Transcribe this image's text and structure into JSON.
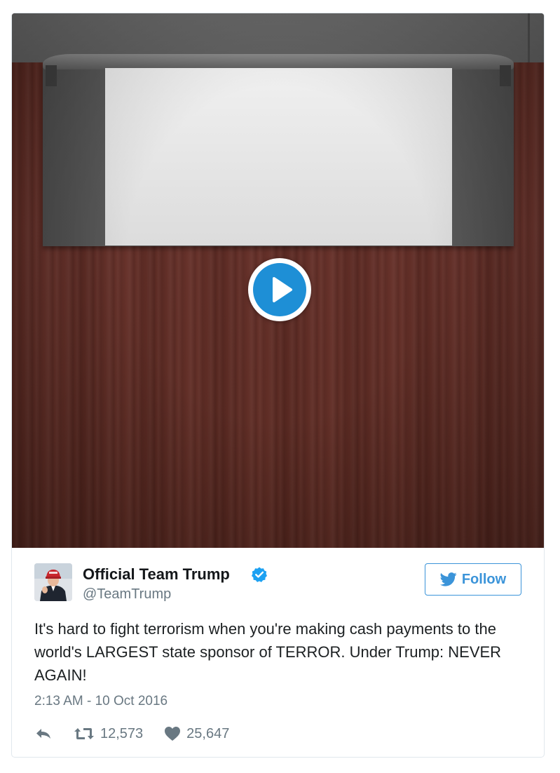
{
  "tweet": {
    "display_name": "Official Team Trump",
    "handle": "@TeamTrump",
    "follow_label": "Follow",
    "text": "It's hard to fight terrorism when you're making cash payments to the world's LARGEST state sponsor of TERROR. Under Trump: NEVER AGAIN!",
    "timestamp": "2:13 AM - 10 Oct 2016",
    "retweet_count": "12,573",
    "like_count": "25,647"
  },
  "media": {
    "type": "video",
    "play_icon": "play-icon"
  },
  "icons": {
    "verified": "verified-badge-icon",
    "bird": "twitter-bird-icon",
    "reply": "reply-icon",
    "retweet": "retweet-icon",
    "like": "heart-icon"
  },
  "colors": {
    "accent": "#1e8fd6",
    "follow": "#3b94d9",
    "verified": "#1da1f2",
    "muted_text": "#697882",
    "main_text": "#1c2022"
  }
}
